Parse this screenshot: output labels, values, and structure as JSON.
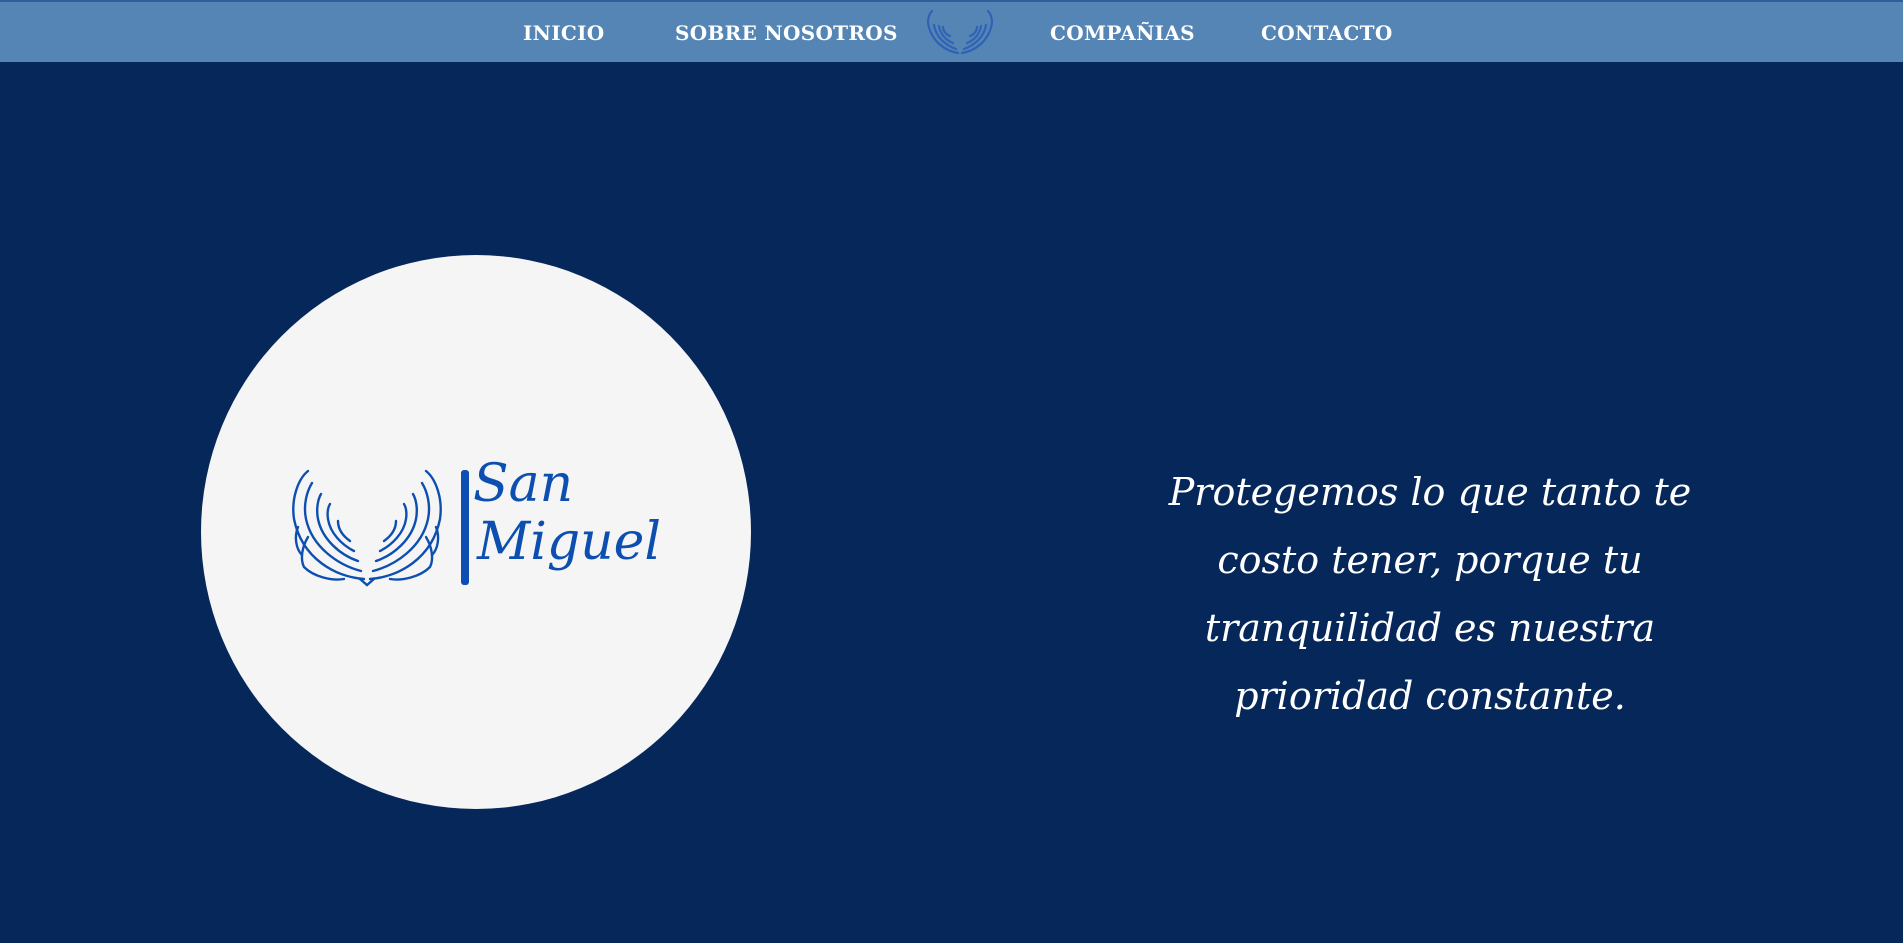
{
  "nav": {
    "items": [
      {
        "label": "INICIO"
      },
      {
        "label": "SOBRE NOSOTROS"
      },
      {
        "label": "COMPAÑIAS"
      },
      {
        "label": "CONTACTO"
      }
    ],
    "logo_icon": "angel-wings-icon"
  },
  "hero": {
    "logo": {
      "icon": "angel-wings-icon",
      "name_line1": "San",
      "name_line2": "Miguel"
    },
    "tagline": "Protegemos lo que tanto te costo tener, porque tu tranquilidad es nuestra prioridad constante."
  },
  "colors": {
    "background": "#06275a",
    "navbar": "#5585b5",
    "logo_blue": "#0d4fb0",
    "circle": "#f5f5f6",
    "text": "#ffffff"
  }
}
